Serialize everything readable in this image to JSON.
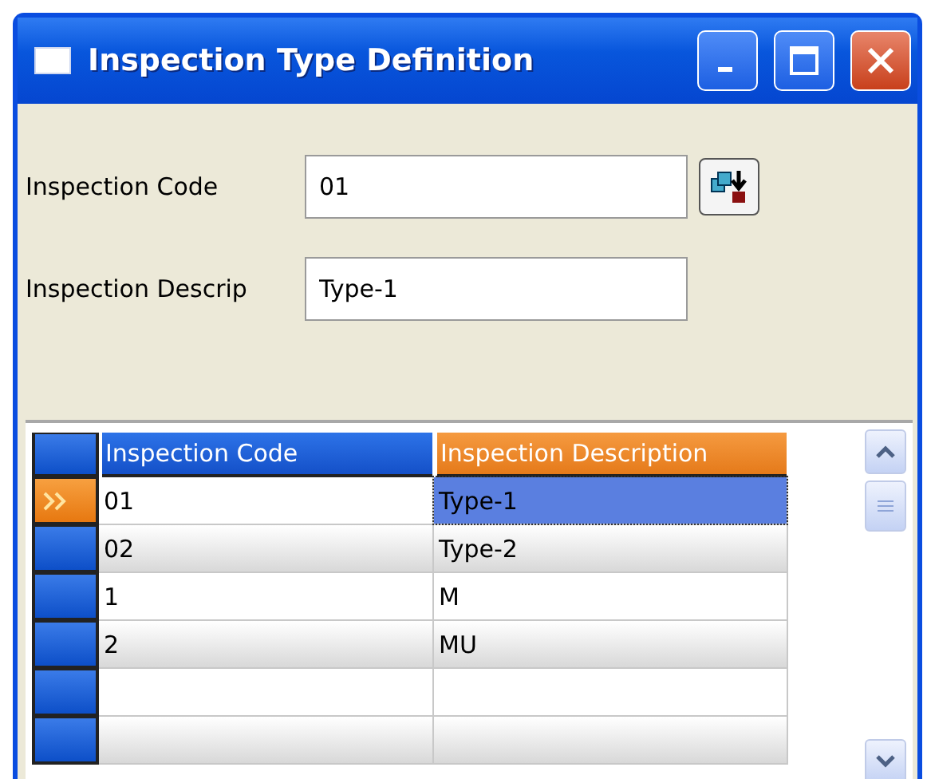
{
  "window": {
    "title": "Inspection Type Definition"
  },
  "form": {
    "fields": [
      {
        "label": "Inspection Code",
        "value": "01"
      },
      {
        "label": "Inspection Descrip",
        "value": "Type-1"
      }
    ]
  },
  "table": {
    "columns": [
      {
        "label": "Inspection Code",
        "selected": false
      },
      {
        "label": "Inspection Description",
        "selected": true
      }
    ],
    "rows": [
      {
        "cells": [
          "01",
          "Type-1"
        ],
        "selected": true
      },
      {
        "cells": [
          "02",
          "Type-2"
        ],
        "selected": false
      },
      {
        "cells": [
          "1",
          "M"
        ],
        "selected": false
      },
      {
        "cells": [
          "2",
          "MU"
        ],
        "selected": false
      }
    ]
  }
}
